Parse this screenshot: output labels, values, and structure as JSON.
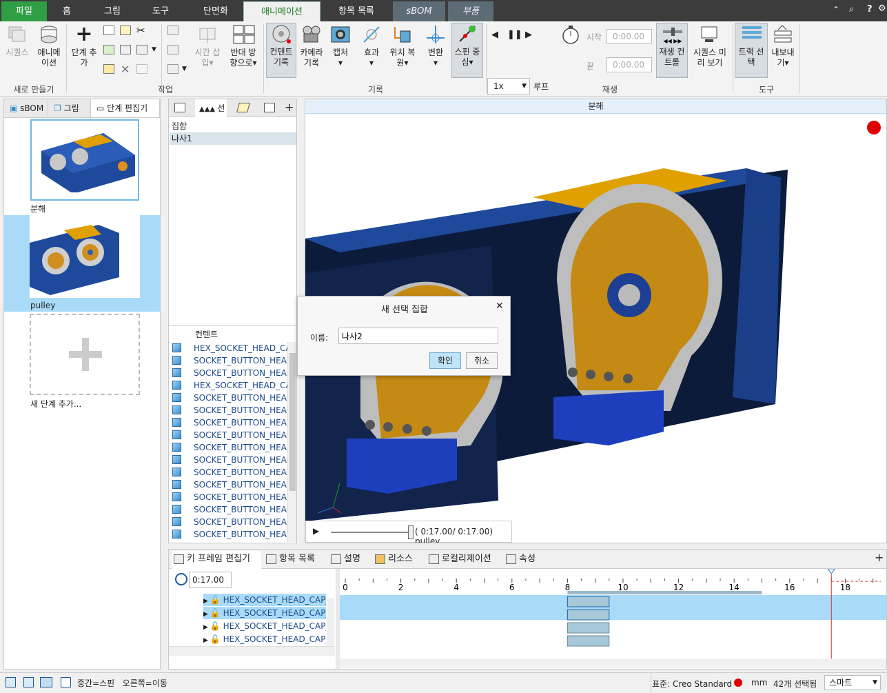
{
  "menubar": {
    "tabs": [
      "파일",
      "홈",
      "그림",
      "도구",
      "단면화",
      "애니메이션",
      "항목 목록",
      "sBOM",
      "부품"
    ],
    "icons": [
      "chevron-up-icon",
      "search-icon",
      "help-icon",
      "settings-icon"
    ],
    "help_label": "?"
  },
  "ribbon": {
    "groups": [
      "새로 만들기",
      "작업",
      "기록",
      "재생",
      "도구"
    ],
    "buttons": {
      "sequence": "시퀀스",
      "animation_1": "애니메",
      "animation_2": "이션",
      "add_step_1": "단계 추",
      "add_step_2": "가",
      "time_insert_1": "시간 삽",
      "time_insert_2": "입▾",
      "reverse_1": "반대 방",
      "reverse_2": "향으로▾",
      "content_rec_1": "컨텐트",
      "content_rec_2": "기록",
      "camera_rec_1": "카메라",
      "camera_rec_2": "기록",
      "capture_1": "캡처",
      "capture_2": "▾",
      "effect_1": "효과",
      "effect_2": "▾",
      "pos_restore_1": "위치 복",
      "pos_restore_2": "원▾",
      "transform_1": "변환",
      "transform_2": "▾",
      "spin_center_1": "스핀 중",
      "spin_center_2": "심▾",
      "range": "범위",
      "playback_ctrl_1": "재생 컨",
      "playback_ctrl_2": "트롤",
      "seq_preview_1": "시퀀스 미",
      "seq_preview_2": "리 보기",
      "track_select_1": "트랙 선",
      "track_select_2": "택",
      "export_1": "내보내",
      "export_2": "기▾"
    },
    "speed_value": "1x",
    "loop_label": "루프",
    "start_label": "시작",
    "end_label": "끝",
    "start_value": "0:00.00",
    "end_value": "0:00.00",
    "range_ticks": "10-20-30"
  },
  "left_panel": {
    "tabs": [
      "sBOM",
      "그림",
      "단계 편집기"
    ],
    "steps": [
      {
        "label": "분해"
      },
      {
        "label": "pulley"
      }
    ],
    "add_step_label": "새 단계 추가..."
  },
  "mid_panel": {
    "tabs": [
      "",
      "선",
      "",
      ""
    ],
    "set_header": "집합",
    "sets": [
      "나사1"
    ],
    "content_header": "컨텐트",
    "contents": [
      "HEX_SOCKET_HEAD_CAP",
      "SOCKET_BUTTON_HEAD",
      "SOCKET_BUTTON_HEAD",
      "HEX_SOCKET_HEAD_CAP",
      "SOCKET_BUTTON_HEAD",
      "SOCKET_BUTTON_HEAD",
      "SOCKET_BUTTON_HEAD",
      "SOCKET_BUTTON_HEAD",
      "SOCKET_BUTTON_HEAD",
      "SOCKET_BUTTON_HEAD",
      "SOCKET_BUTTON_HEAD",
      "SOCKET_BUTTON_HEAD",
      "SOCKET_BUTTON_HEAD",
      "SOCKET_BUTTON_HEAD",
      "SOCKET_BUTTON_HEAD",
      "SOCKET_BUTTON_HEAD"
    ]
  },
  "viewport": {
    "title": "분해",
    "record_color": "#e00000",
    "player_time": "( 0:17.00/ 0:17.00) pulley",
    "player_progress": 1.0
  },
  "dialog": {
    "title": "새 선택 집합",
    "name_label": "이름:",
    "name_value": "나사2",
    "ok_label": "확인",
    "cancel_label": "취소"
  },
  "bottom_panel": {
    "tabs": [
      "키 프레임 편집기",
      "항목 목록",
      "설명",
      "리소스",
      "로컬리제이션",
      "속성"
    ],
    "time_value": "0:17.00",
    "tree_rows": [
      "HEX_SOCKET_HEAD_CAP_",
      "HEX_SOCKET_HEAD_CAP_",
      "HEX_SOCKET_HEAD_CAP_",
      "HEX_SOCKET_HEAD_CAP_"
    ],
    "ruler_labels": [
      "0",
      "2",
      "4",
      "6",
      "8",
      "10",
      "12",
      "14",
      "16",
      "18"
    ],
    "current_time": 17.5
  },
  "status": {
    "hint": "중간=스핀   오른쪽=이동",
    "standard": "표준: Creo Standard",
    "unit": "mm",
    "selected": "42개 선택됨",
    "mode": "스마트"
  }
}
